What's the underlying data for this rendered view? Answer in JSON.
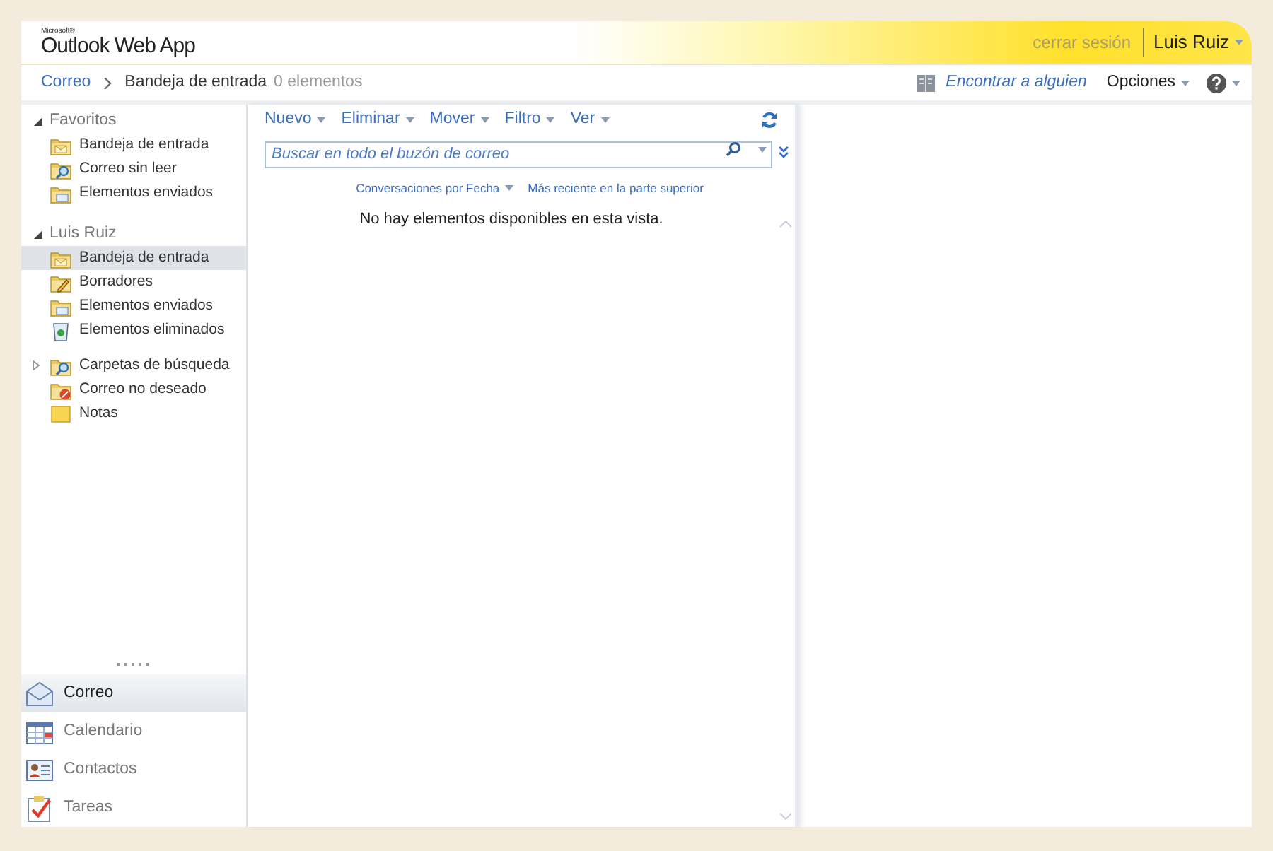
{
  "header": {
    "logo_small": "Microsoft®",
    "logo": "Outlook Web App",
    "sign_out": "cerrar sesión",
    "user": "Luis Ruiz"
  },
  "breadcrumb": {
    "root": "Correo",
    "current": "Bandeja de entrada",
    "count": "0 elementos"
  },
  "top_links": {
    "find": "Encontrar a alguien",
    "options": "Opciones"
  },
  "groups": [
    {
      "title": "Favoritos",
      "expanded": true,
      "items": [
        {
          "label": "Bandeja de entrada",
          "kind": "inbox",
          "selected": false
        },
        {
          "label": "Correo sin leer",
          "kind": "search",
          "selected": false
        },
        {
          "label": "Elementos enviados",
          "kind": "sent",
          "selected": false
        }
      ]
    },
    {
      "title": "Luis Ruiz",
      "expanded": true,
      "items": [
        {
          "label": "Bandeja de entrada",
          "kind": "inbox",
          "selected": true
        },
        {
          "label": "Borradores",
          "kind": "drafts",
          "selected": false
        },
        {
          "label": "Elementos enviados",
          "kind": "sent",
          "selected": false
        },
        {
          "label": "Elementos eliminados",
          "kind": "deleted",
          "selected": false
        },
        {
          "label": "Carpetas de búsqueda",
          "kind": "search",
          "selected": false,
          "expanded": false
        },
        {
          "label": "Correo no deseado",
          "kind": "junk",
          "selected": false
        },
        {
          "label": "Notas",
          "kind": "notes",
          "selected": false
        }
      ]
    }
  ],
  "modules": [
    {
      "label": "Correo",
      "kind": "mail",
      "selected": true
    },
    {
      "label": "Calendario",
      "kind": "calendar",
      "selected": false
    },
    {
      "label": "Contactos",
      "kind": "contacts",
      "selected": false
    },
    {
      "label": "Tareas",
      "kind": "tasks",
      "selected": false
    }
  ],
  "toolbar": [
    "Nuevo",
    "Eliminar",
    "Mover",
    "Filtro",
    "Ver"
  ],
  "search": {
    "placeholder": "Buscar en todo el buzón de correo"
  },
  "sort": {
    "arrange": "Conversaciones por Fecha",
    "order": "Más reciente en la parte superior"
  },
  "empty_message": "No hay elementos disponibles en esta vista."
}
